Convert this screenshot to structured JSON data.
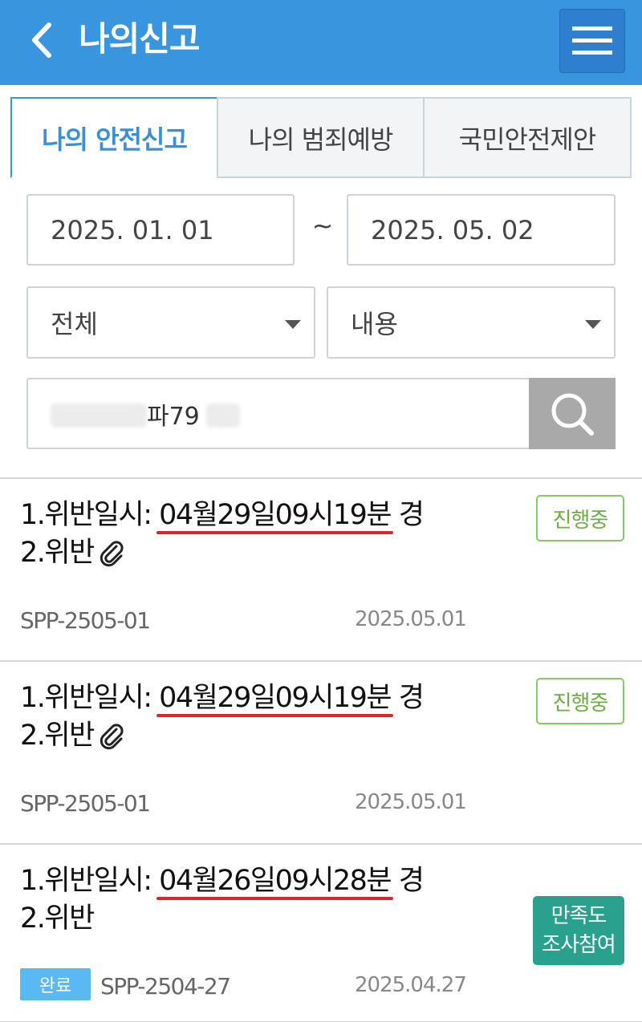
{
  "header": {
    "title": "나의신고",
    "back_icon": "chevron-left-icon",
    "menu_icon": "hamburger-menu-icon"
  },
  "tabs": [
    {
      "label": "나의 안전신고",
      "active": true
    },
    {
      "label": "나의 범죄예방",
      "active": false
    },
    {
      "label": "국민안전제안",
      "active": false
    }
  ],
  "filters": {
    "date_from": "2025. 01. 01",
    "separator": "~",
    "date_to": "2025. 05. 02",
    "status_select": "전체",
    "type_select": "내용"
  },
  "search": {
    "value": "파79",
    "button_icon": "search-icon"
  },
  "reports": [
    {
      "title_prefix": "1.위반일시: ",
      "title_highlight": "04월29일09시19분",
      "title_suffix": " 경",
      "line2": "2.위반",
      "has_attachment": true,
      "badge": "진행중",
      "ref": "SPP-2505-01",
      "date": "2025.05.01"
    },
    {
      "title_prefix": "1.위반일시: ",
      "title_highlight": "04월29일09시19분",
      "title_suffix": " 경",
      "line2": "2.위반",
      "has_attachment": true,
      "badge": "진행중",
      "ref": "SPP-2505-01",
      "date": "2025.05.01"
    },
    {
      "title_prefix": "1.위반일시: ",
      "title_highlight": "04월26일09시28분",
      "title_suffix": " 경",
      "line2": "2.위반",
      "has_attachment": false,
      "badge_line1": "만족도",
      "badge_line2": "조사참여",
      "status": "완료",
      "ref": "SPP-2504-27",
      "date": "2025.04.27"
    }
  ],
  "colors": {
    "appbar": "#3a95df",
    "active_tab": "#3a8fd9",
    "progress_badge": "#6cad45",
    "survey_badge": "#2aa08f",
    "done_status": "#5ab8f3",
    "highlight_underline": "#d8262c"
  }
}
